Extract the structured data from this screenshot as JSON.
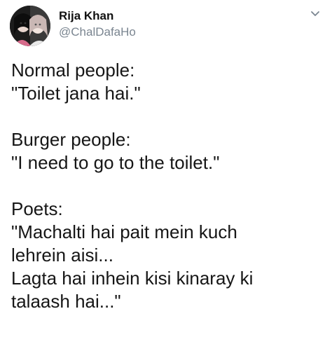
{
  "tweet": {
    "author": {
      "display_name": "Rija Khan",
      "handle": "@ChalDafaHo",
      "avatar_icon": "profile-photo"
    },
    "menu_icon": "chevron-down-icon",
    "blocks": [
      {
        "heading": "Normal people:",
        "lines": [
          "\"Toilet jana hai.\""
        ]
      },
      {
        "heading": "Burger people:",
        "lines": [
          "\"I need to go to the toilet.\""
        ]
      },
      {
        "heading": "Poets:",
        "lines": [
          "\"Machalti hai pait mein kuch",
          "lehrein aisi...",
          "Lagta hai inhein kisi kinaray ki",
          "talaash hai...\""
        ]
      }
    ]
  }
}
